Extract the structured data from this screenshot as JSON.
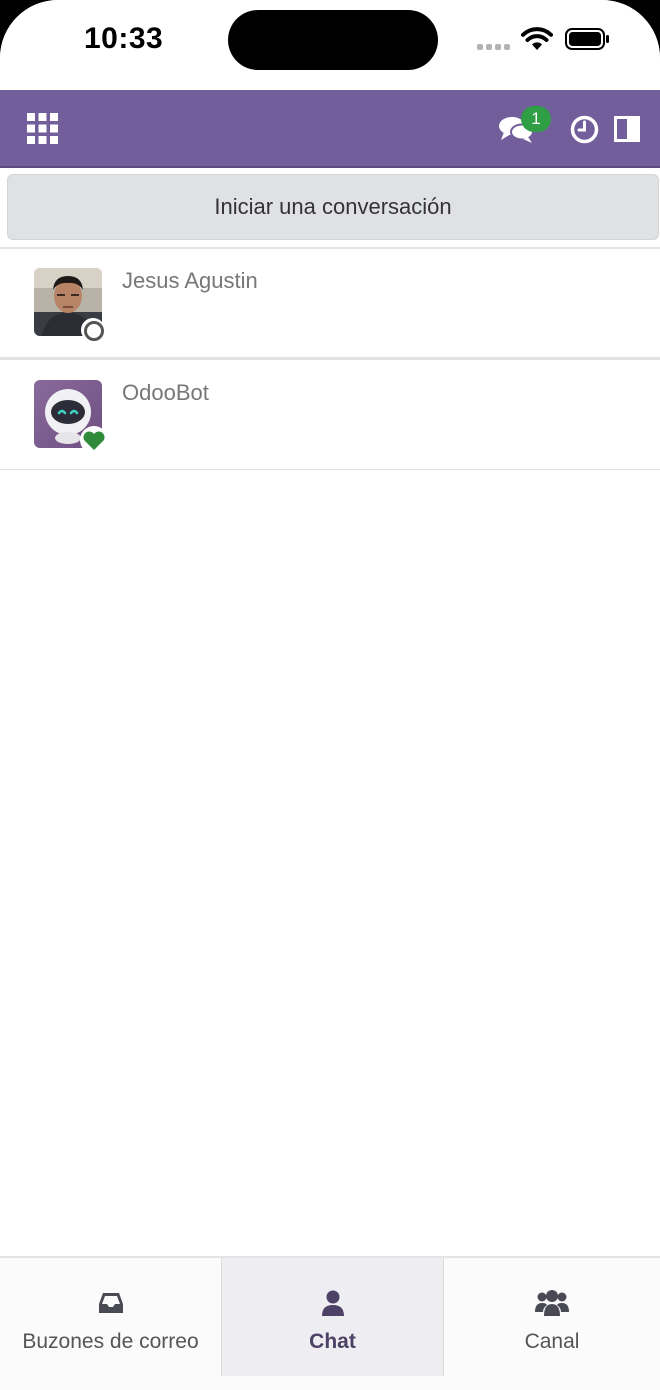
{
  "status_bar": {
    "time": "10:33"
  },
  "header": {
    "chat_badge_count": "1",
    "accent_color": "#715e9a",
    "badge_color": "#2f9e44"
  },
  "start_conversation": {
    "label": "Iniciar una conversación"
  },
  "conversations": [
    {
      "name": "Jesus Agustin",
      "status": "offline"
    },
    {
      "name": "OdooBot",
      "status": "bot-online"
    }
  ],
  "tabs": [
    {
      "label": "Buzones de correo",
      "icon": "inbox-icon",
      "active": false
    },
    {
      "label": "Chat",
      "icon": "user-icon",
      "active": true
    },
    {
      "label": "Canal",
      "icon": "users-icon",
      "active": false
    }
  ]
}
